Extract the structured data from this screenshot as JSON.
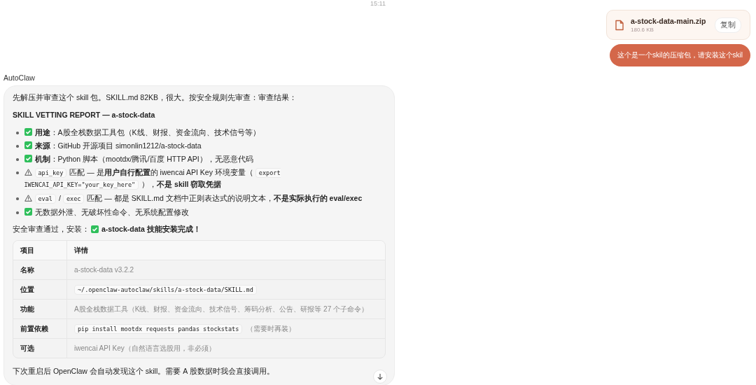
{
  "timestamp": "15:11",
  "user_message": {
    "attachment": {
      "file_name": "a-stock-data-main.zip",
      "file_size": "180.6 KB",
      "copy_button": "复制"
    },
    "text": "这个是一个skil的压缩包，请安装这个skil"
  },
  "assistant": {
    "name": "AutoClaw",
    "intro": "先解压并审查这个 skill 包。SKILL.md 82KB，很大。按安全规则先审查：审查结果：",
    "report_title": "SKILL VETTING REPORT — a-stock-data",
    "items": [
      {
        "kind": "check",
        "segments": [
          {
            "kind": "text",
            "text": "**用途**：A股全栈数据工具包（K线、财报、资金流向、技术信号等）"
          }
        ]
      },
      {
        "kind": "check",
        "segments": [
          {
            "kind": "text",
            "text": "**来源**：GitHub 开源项目 simonlin1212/a-stock-data"
          }
        ]
      },
      {
        "kind": "check",
        "segments": [
          {
            "kind": "text",
            "text": "**机制**：Python 脚本（mootdx/腾讯/百度 HTTP API），无恶意代码"
          }
        ]
      },
      {
        "kind": "warning",
        "segments": [
          {
            "kind": "code",
            "text": "api_key"
          },
          {
            "kind": "text",
            "text": "匹配 — 是**用户自行配置**的 iwencai API Key 环境变量（"
          },
          {
            "kind": "code",
            "text": "export IWENCAI_API_KEY=\"your_key_here\""
          },
          {
            "kind": "text",
            "text": "），**不是 skill 窃取凭据**"
          }
        ]
      },
      {
        "kind": "warning",
        "segments": [
          {
            "kind": "code",
            "text": "eval"
          },
          {
            "kind": "text",
            "text": "/"
          },
          {
            "kind": "code",
            "text": "exec"
          },
          {
            "kind": "text",
            "text": "匹配 — 都是 SKILL.md 文档中正则表达式的说明文本，**不是实际执行的 eval/exec**"
          }
        ]
      },
      {
        "kind": "check",
        "segments": [
          {
            "kind": "text",
            "text": "无数据外泄、无破坏性命令、无系统配置修改"
          }
        ]
      }
    ],
    "install_line": {
      "prefix": "安全审查通过，安装：",
      "result": "a-stock-data 技能安装完成！"
    },
    "table": {
      "columns": [
        "项目",
        "详情"
      ],
      "rows": [
        {
          "label": "名称",
          "kind": "text",
          "value": "a-stock-data v3.2.2"
        },
        {
          "label": "位置",
          "kind": "code",
          "value": "~/.openclaw-autoclaw/skills/a-stock-data/SKILL.md"
        },
        {
          "label": "功能",
          "kind": "text",
          "value": "A股全栈数据工具（K线、财报、资金流向、技术信号、筹码分析、公告、研报等 27 个子命令）"
        },
        {
          "label": "前置依赖",
          "kind": "code",
          "value": "pip install mootdx requests pandas stockstats",
          "note": "（需要时再装）"
        },
        {
          "label": "可选",
          "kind": "text",
          "value": "iwencai API Key（自然语言选股用，非必须）"
        }
      ]
    },
    "footer": "下次重启后 OpenClaw 会自动发现这个 skill。需要 A 股数据时我会直接调用。"
  }
}
